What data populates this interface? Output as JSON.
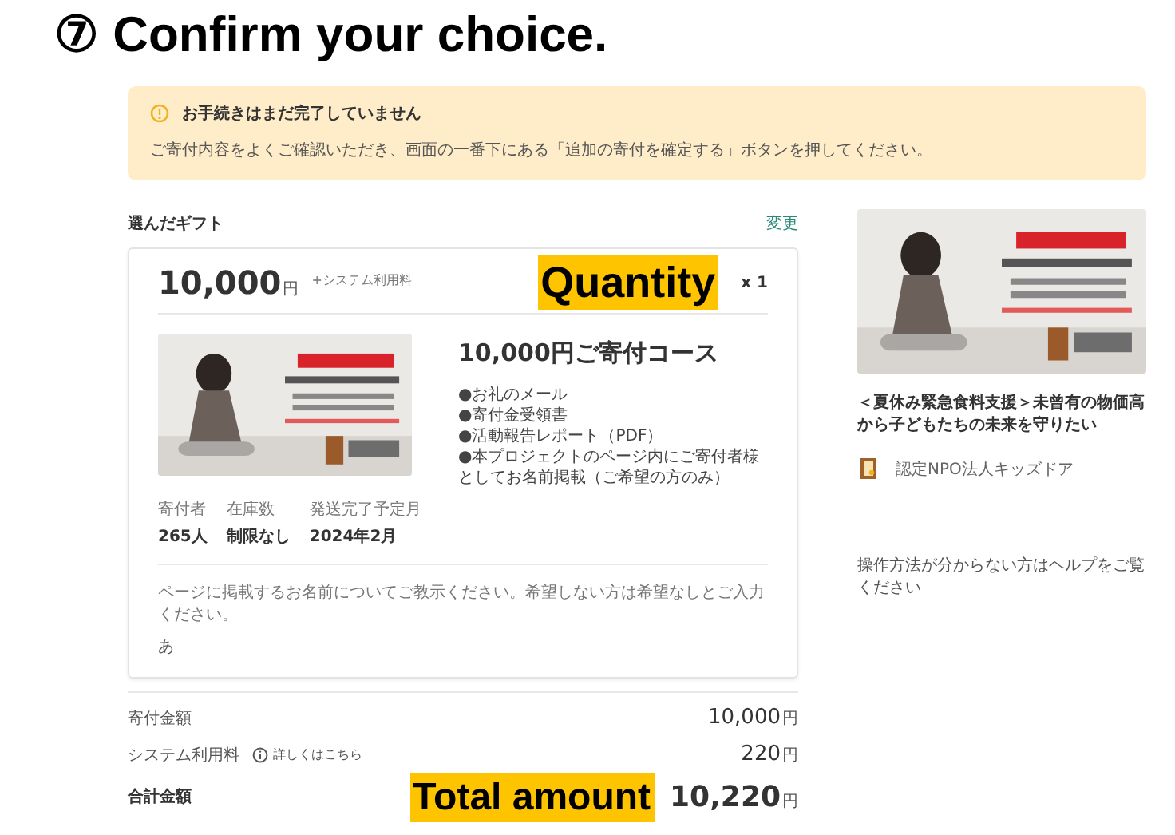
{
  "heading": "⑦ Confirm your choice.",
  "notice": {
    "title": "お手続きはまだ完了していません",
    "body": "ご寄付内容をよくご確認いただき、画面の一番下にある「追加の寄付を確定する」ボタンを押してください。"
  },
  "gift_section": {
    "title": "選んだギフト",
    "change_link": "変更"
  },
  "gift": {
    "price": "10,000",
    "price_unit": "円",
    "fee_note": "+システム利用料",
    "quantity": "x 1",
    "course_title": "10,000円ご寄付コース",
    "benefits": [
      "●お礼のメール",
      "●寄付金受領書",
      "●活動報告レポート（PDF）",
      "●本プロジェクトのページ内にご寄付者様としてお名前掲載（ご希望の方のみ）"
    ],
    "stats": [
      {
        "label": "寄付者",
        "value": "265人"
      },
      {
        "label": "在庫数",
        "value": "制限なし"
      },
      {
        "label": "発送完了予定月",
        "value": "2024年2月"
      }
    ],
    "name_prompt": "ページに掲載するお名前についてご教示ください。希望しない方は希望なしとご入力ください。",
    "name_value": "あ"
  },
  "summary": [
    {
      "kind": "plain",
      "label": "寄付金額",
      "amount": "10,000",
      "unit": "円"
    },
    {
      "kind": "fee",
      "label": "システム利用料",
      "link": "詳しくはこちら",
      "amount": "220",
      "unit": "円"
    },
    {
      "kind": "total",
      "label": "合計金額",
      "amount": "10,220",
      "unit": "円"
    }
  ],
  "annotations": {
    "quantity": "Quantity",
    "total": "Total amount"
  },
  "sidebar": {
    "project_title": "＜夏休み緊急食料支援＞未曾有の物価高から子どもたちの未来を守りたい",
    "organization": "認定NPO法人キッズドア",
    "help_text": "操作方法が分からない方はヘルプをご覧ください"
  }
}
